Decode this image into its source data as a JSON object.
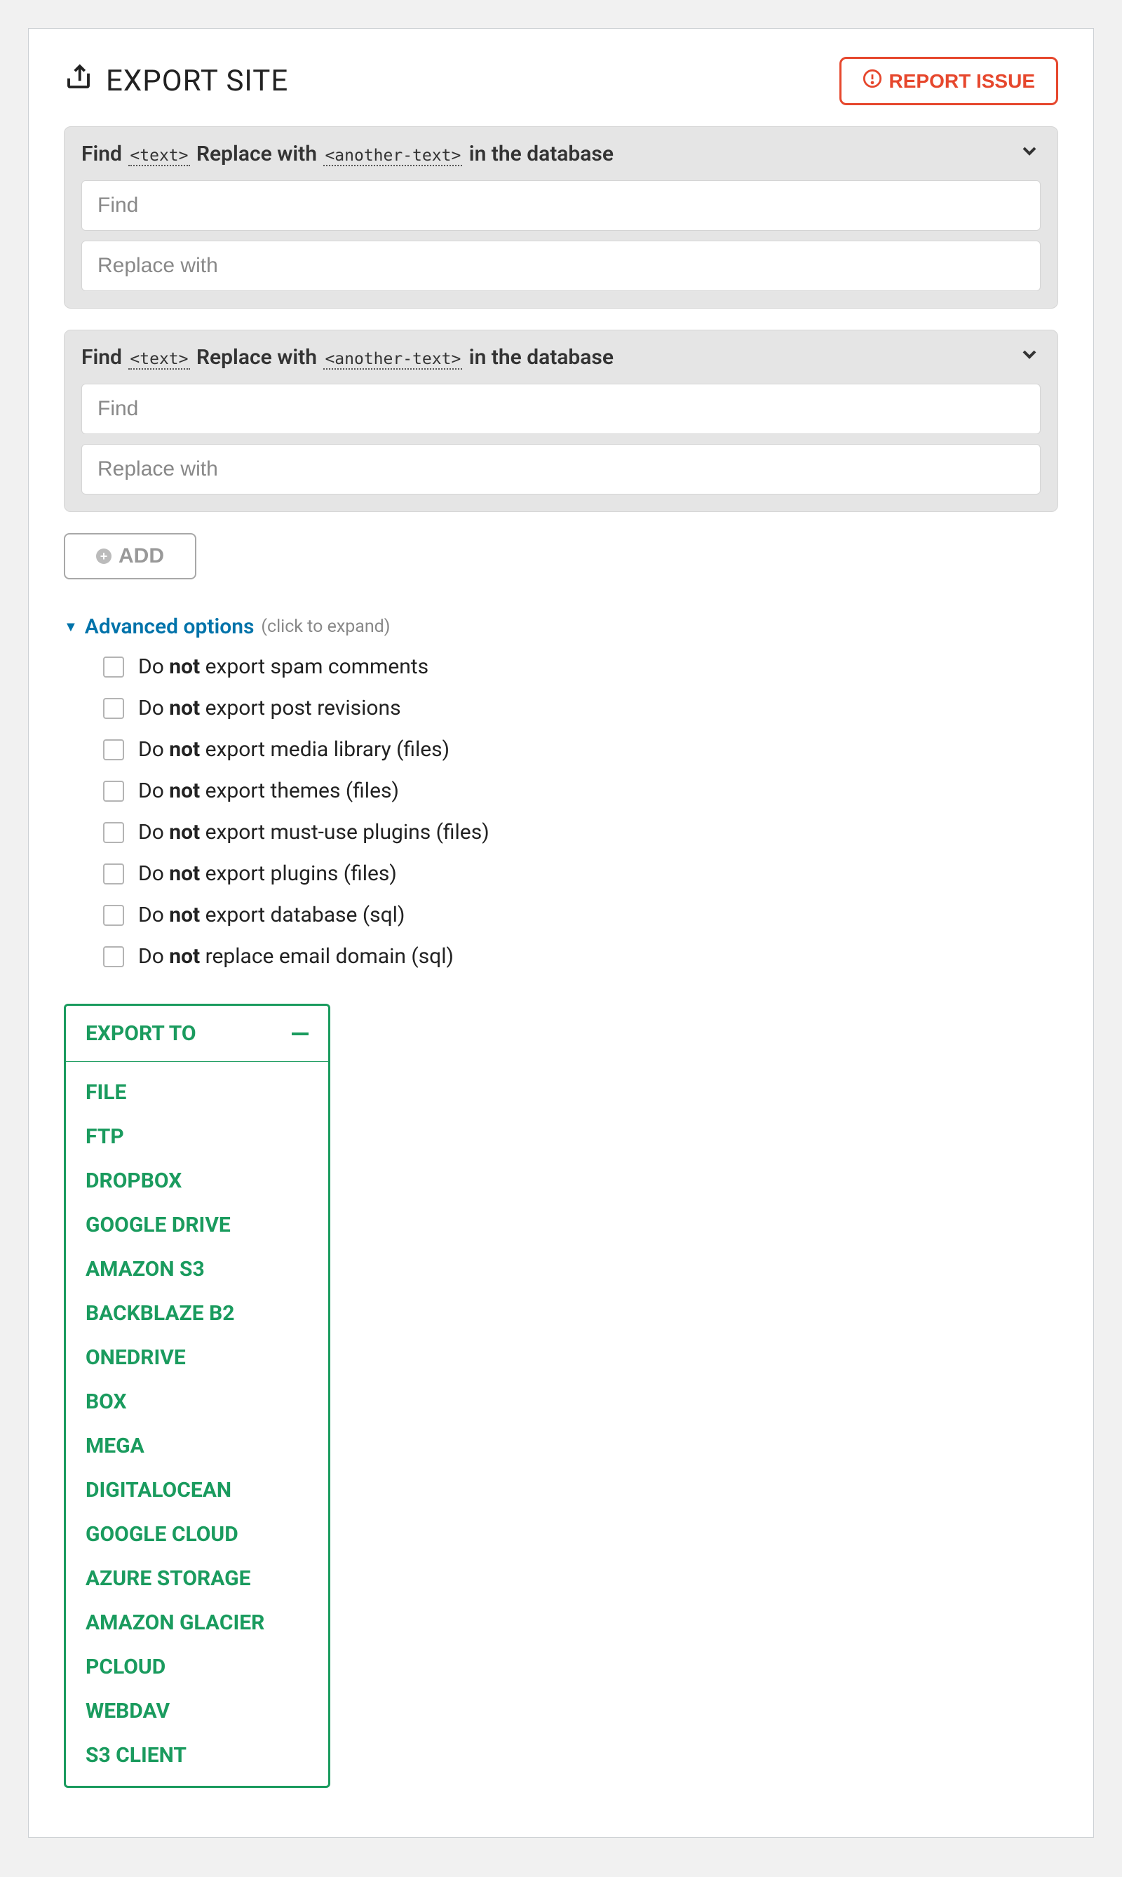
{
  "report_issue": "REPORT ISSUE",
  "page_title": "EXPORT SITE",
  "find_replace_header": {
    "p1": "Find",
    "tok1": "<text>",
    "p2": "Replace with",
    "tok2": "<another-text>",
    "p3": "in the database"
  },
  "placeholders": {
    "find": "Find",
    "replace": "Replace with"
  },
  "add_button": "ADD",
  "advanced": {
    "label": "Advanced options",
    "hint": "(click to expand)",
    "items": [
      {
        "suffix": "export spam comments"
      },
      {
        "suffix": "export post revisions"
      },
      {
        "suffix": "export media library (files)"
      },
      {
        "suffix": "export themes (files)"
      },
      {
        "suffix": "export must-use plugins (files)"
      },
      {
        "suffix": "export plugins (files)"
      },
      {
        "suffix": "export database (sql)"
      },
      {
        "suffix": "replace email domain (sql)"
      }
    ],
    "do_text": "Do",
    "not_text": "not"
  },
  "export": {
    "header": "EXPORT TO",
    "targets": [
      "FILE",
      "FTP",
      "DROPBOX",
      "GOOGLE DRIVE",
      "AMAZON S3",
      "BACKBLAZE B2",
      "ONEDRIVE",
      "BOX",
      "MEGA",
      "DIGITALOCEAN",
      "GOOGLE CLOUD",
      "AZURE STORAGE",
      "AMAZON GLACIER",
      "PCLOUD",
      "WEBDAV",
      "S3 CLIENT"
    ]
  }
}
